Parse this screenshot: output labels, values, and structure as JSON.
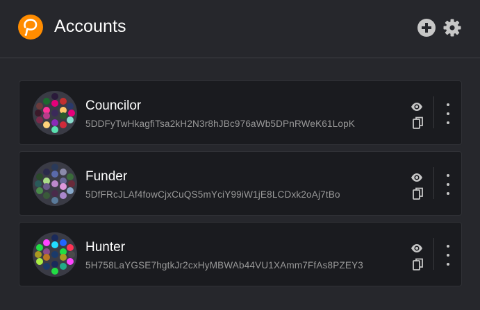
{
  "header": {
    "title": "Accounts",
    "logo_icon": "polkadot-logo-icon",
    "add_icon": "plus-circle-icon",
    "settings_icon": "gear-icon"
  },
  "colors": {
    "background": "#26272c",
    "card": "#1a1b1f",
    "accent": "#ff8c00",
    "address_text": "#9a9a9a"
  },
  "accounts": [
    {
      "name": "Councilor",
      "address": "5DDFyTwHkagfiTsa2kH2N3r8hJBc976aWb5DPnRWeK61LopK",
      "identicon_colors": [
        "#2a1a3a",
        "#e6007a",
        "#1b6b2e",
        "#c03030",
        "#6b3b3b",
        "#2a3a6b",
        "#ff3399",
        "#ffc86b",
        "#3b2a5a",
        "#7a2a4a",
        "#88ddcc",
        "#b83b8a",
        "#2a5a2a",
        "#ffd27a",
        "#d02a3a",
        "#8a2ab8",
        "#5ae0b0",
        "#3b1a2a",
        "#e6007a"
      ]
    },
    {
      "name": "Funder",
      "address": "5DfFRcJLAf4fowCjxCuQS5mYciY99iW1jE8LCDxk2oAj7tBo",
      "identicon_colors": [
        "#2a3a5a",
        "#5a6aaa",
        "#2a2a4a",
        "#8a8aaa",
        "#2a4a2a",
        "#3a6a3a",
        "#aadd88",
        "#6a6a9a",
        "#bb88cc",
        "#4a8a4a",
        "#88aacc",
        "#6a5a8a",
        "#dd99dd",
        "#3a5a3a",
        "#aa88cc",
        "#4a2a4a",
        "#5a7a9a",
        "#2a5a5a",
        "#6a2a3a"
      ]
    },
    {
      "name": "Hunter",
      "address": "5H758LaYGSE7hgtkJr2cxHyMBWAb44VU1XAmm7FfAs8PZEY3",
      "identicon_colors": [
        "#1a2a5a",
        "#22ddff",
        "#ff44ff",
        "#2266ff",
        "#22dd44",
        "#ff3355",
        "#8a4a8a",
        "#22dd44",
        "#1a3a6a",
        "#aaee44",
        "#ff44ff",
        "#bb7722",
        "#aa9a22",
        "#1a3a6a",
        "#22aa88",
        "#1a2a5a",
        "#22dd44",
        "#aa9a22",
        "#4a4a4a"
      ]
    }
  ],
  "actions": {
    "show_icon": "eye-icon",
    "copy_icon": "copy-icon",
    "menu_icon": "more-vertical-icon"
  }
}
